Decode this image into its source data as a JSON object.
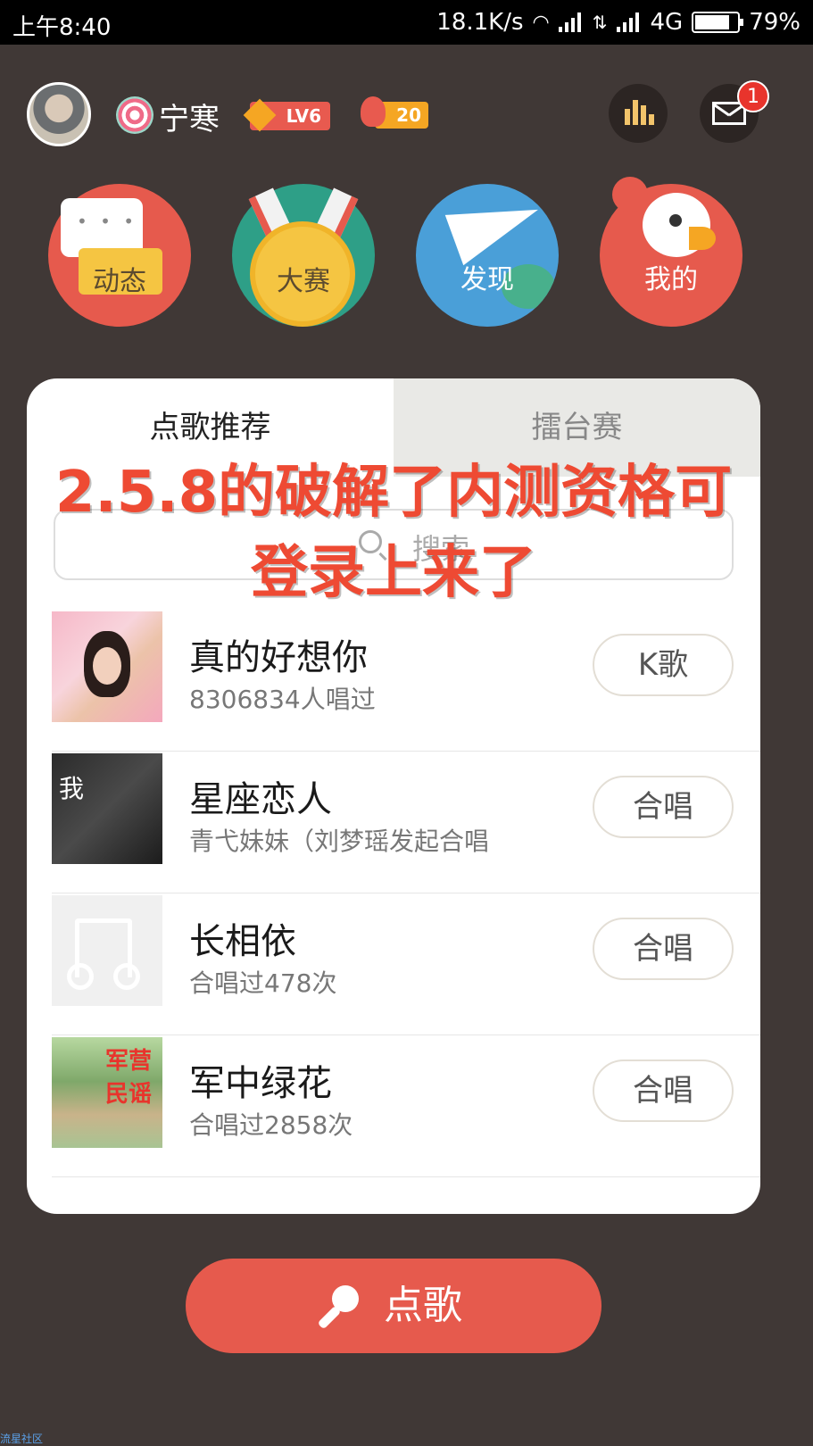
{
  "status_bar": {
    "time": "上午8:40",
    "net_speed": "18.1K/s",
    "network": "4G",
    "battery": "79%"
  },
  "header": {
    "username": "宁寒",
    "level_badge": "LV6",
    "flower_count": "20",
    "mail_badge_count": "1"
  },
  "nav": [
    {
      "label": "动态",
      "icon": "feed-chat-icon"
    },
    {
      "label": "大赛",
      "icon": "medal-icon"
    },
    {
      "label": "发现",
      "icon": "paper-plane-globe-icon"
    },
    {
      "label": "我的",
      "icon": "parrot-icon"
    }
  ],
  "tabs": {
    "recommend": "点歌推荐",
    "arena": "擂台赛"
  },
  "search": {
    "placeholder": "搜索"
  },
  "overlay_text": {
    "line1": "2.5.8的破解了内测资格可",
    "line2": "登录上来了"
  },
  "songs": [
    {
      "title": "真的好想你",
      "subtitle": "8306834人唱过",
      "action": "K歌"
    },
    {
      "title": "星座恋人",
      "subtitle": "青弋妹妹（刘梦瑶发起合唱",
      "action": "合唱",
      "cover_text": "我"
    },
    {
      "title": "长相依",
      "subtitle": "合唱过478次",
      "action": "合唱"
    },
    {
      "title": "军中绿花",
      "subtitle": "合唱过2858次",
      "action": "合唱",
      "cover_text": "军营民谣"
    }
  ],
  "primary_button": {
    "label": "点歌"
  },
  "watermark": "流星社区",
  "colors": {
    "background": "#403836",
    "accent_red": "#e65a4d",
    "overlay_red": "#ee4a33"
  }
}
